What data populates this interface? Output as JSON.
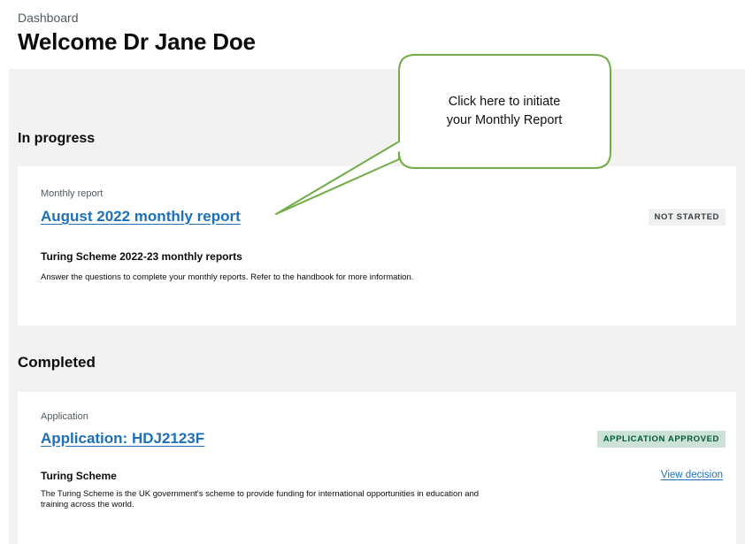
{
  "header": {
    "caption": "Dashboard",
    "title": "Welcome Dr Jane Doe"
  },
  "callout": {
    "line1": "Click here to initiate",
    "line2": "your Monthly Report",
    "border_color": "#70ad47"
  },
  "in_progress": {
    "heading": "In progress",
    "card": {
      "caption": "Monthly report",
      "link": "August 2022 monthly report",
      "status": "NOT STARTED",
      "subheading": "Turing Scheme 2022-23 monthly reports",
      "description": "Answer the questions to complete your monthly reports. Refer to the handbook for more information."
    }
  },
  "completed": {
    "heading": "Completed",
    "card": {
      "caption": "Application",
      "link": "Application: HDJ2123F",
      "status": "APPLICATION APPROVED",
      "action": "View decision",
      "subheading": "Turing Scheme",
      "description": "The Turing Scheme is the UK government's scheme to provide funding for international opportunities in education and training across the world."
    }
  },
  "colors": {
    "link": "#1d70b8",
    "panel_bg": "#f3f2f1",
    "tag_grey_bg": "#eeefef",
    "tag_green_bg": "#cce2d8",
    "tag_green_text": "#005a30"
  }
}
